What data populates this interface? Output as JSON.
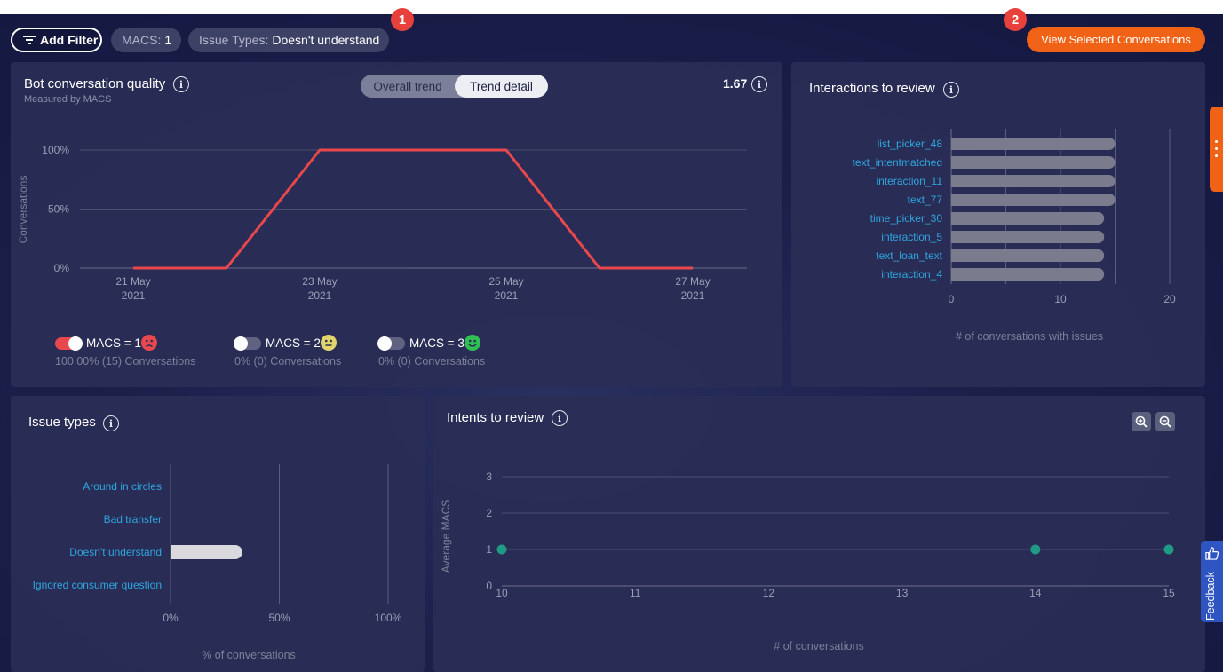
{
  "filters": {
    "add_filter_label": "Add Filter",
    "macs_chip": {
      "key": "MACS:",
      "value": "1"
    },
    "issue_chip": {
      "key": "Issue Types:",
      "value": "Doesn't understand"
    }
  },
  "badges": {
    "one": "1",
    "two": "2"
  },
  "view_button_label": "View Selected Conversations",
  "bot_quality": {
    "title": "Bot conversation quality",
    "subtitle": "Measured by MACS",
    "score": "1.67",
    "tabs": {
      "overall": "Overall trend",
      "detail": "Trend detail"
    },
    "chart_data": {
      "type": "line",
      "x": [
        "2021-05-21",
        "2021-05-22",
        "2021-05-23",
        "2021-05-24",
        "2021-05-25",
        "2021-05-26",
        "2021-05-27"
      ],
      "x_tick_labels": [
        [
          "21 May",
          "2021"
        ],
        [
          "23 May",
          "2021"
        ],
        [
          "25 May",
          "2021"
        ],
        [
          "27 May",
          "2021"
        ]
      ],
      "series": [
        {
          "name": "MACS = 1",
          "values": [
            0,
            0,
            100,
            100,
            100,
            0,
            0
          ],
          "color": "#e8484d"
        }
      ],
      "ylabel": "Conversations",
      "y_tick_labels": [
        "100%",
        "50%",
        "0%"
      ],
      "ylim": [
        0,
        100
      ],
      "grid": true
    },
    "legend": [
      {
        "label": "MACS = 1",
        "sub": "100.00% (15) Conversations",
        "on": true,
        "face": "sad",
        "face_color": "#e8484d"
      },
      {
        "label": "MACS = 2",
        "sub": "0% (0) Conversations",
        "on": false,
        "face": "neutral",
        "face_color": "#e3d36b"
      },
      {
        "label": "MACS = 3",
        "sub": "0% (0) Conversations",
        "on": false,
        "face": "happy",
        "face_color": "#2fbf52"
      }
    ]
  },
  "interactions": {
    "title": "Interactions to review",
    "xlabel": "# of conversations with issues",
    "chart_data": {
      "type": "bar",
      "orientation": "horizontal",
      "categories": [
        "list_picker_48",
        "text_intentmatched",
        "interaction_11",
        "text_77",
        "time_picker_30",
        "interaction_5",
        "text_loan_text",
        "interaction_4"
      ],
      "values": [
        15,
        15,
        15,
        15,
        14,
        14,
        14,
        14
      ],
      "xlim": [
        0,
        20
      ],
      "x_tick_labels": [
        "0",
        "10",
        "20"
      ],
      "xlabel": "# of conversations with issues"
    }
  },
  "issue_types": {
    "title": "Issue types",
    "xlabel": "% of conversations",
    "chart_data": {
      "type": "bar",
      "orientation": "horizontal",
      "categories": [
        "Around in circles",
        "Bad transfer",
        "Doesn't understand",
        "Ignored consumer question"
      ],
      "values": [
        0,
        0,
        33,
        0
      ],
      "xlim": [
        0,
        100
      ],
      "x_tick_labels": [
        "0%",
        "50%",
        "100%"
      ],
      "xlabel": "% of conversations"
    }
  },
  "intents": {
    "title": "Intents to review",
    "chart_data": {
      "type": "scatter",
      "points": [
        {
          "x": 10,
          "y": 1
        },
        {
          "x": 14,
          "y": 1
        },
        {
          "x": 15,
          "y": 1
        }
      ],
      "xlim": [
        10,
        15
      ],
      "ylim": [
        0,
        3
      ],
      "x_tick_labels": [
        "10",
        "11",
        "12",
        "13",
        "14",
        "15"
      ],
      "y_tick_labels": [
        "0",
        "1",
        "2",
        "3"
      ],
      "xlabel": "# of conversations",
      "ylabel": "Average MACS",
      "color": "#1f9a84"
    }
  },
  "feedback_label": "Feedback",
  "colors": {
    "accent": "#f06316",
    "badge": "#e8413c",
    "link": "#2fa6e0",
    "line": "#e8484d"
  }
}
